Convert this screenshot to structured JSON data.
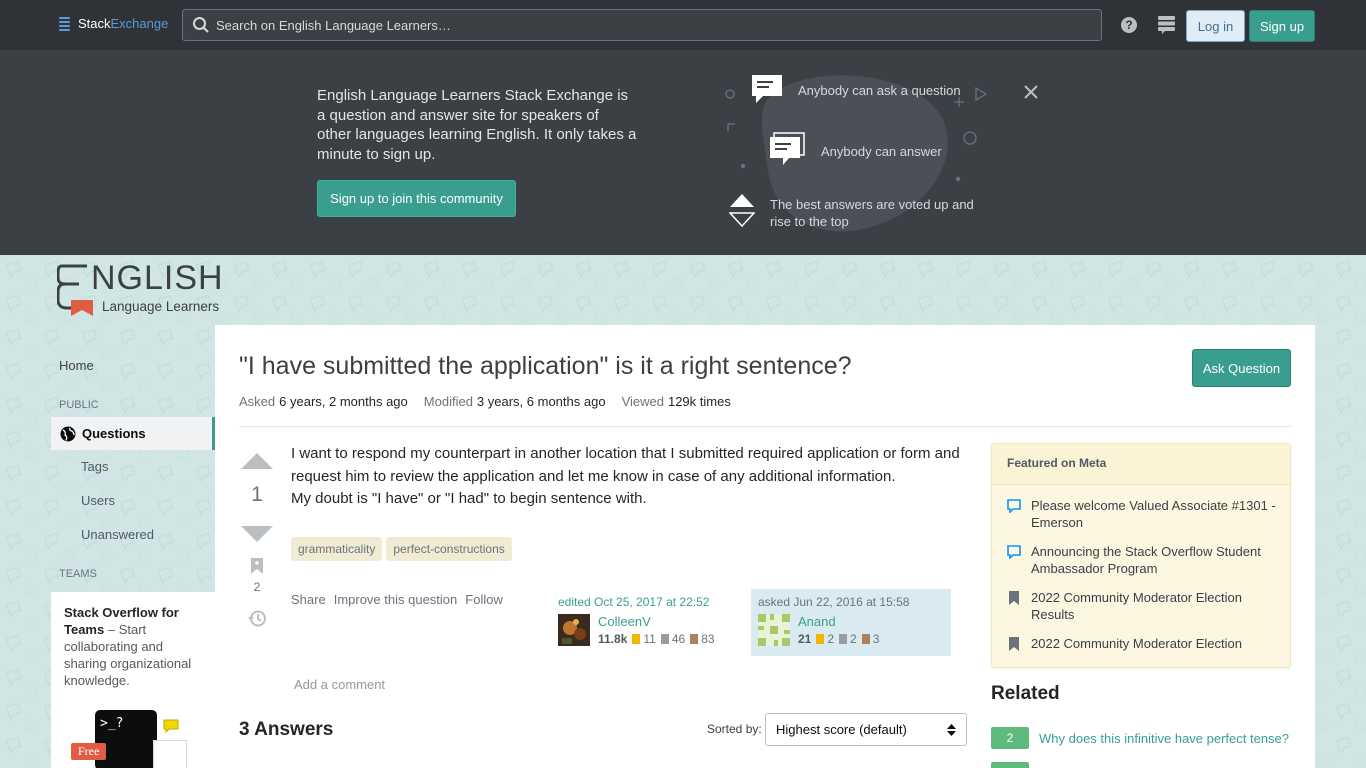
{
  "topbar": {
    "logo_stack": "Stack",
    "logo_exchange": "Exchange",
    "search_placeholder": "Search on English Language Learners…",
    "login_label": "Log in",
    "signup_label": "Sign up"
  },
  "banner": {
    "blurb": "English Language Learners Stack Exchange is a question and answer site for speakers of other languages learning English. It only takes a minute to sign up.",
    "join_label": "Sign up to join this community",
    "features": [
      "Anybody can ask a question",
      "Anybody can answer",
      "The best answers are voted up and rise to the top"
    ]
  },
  "site_logo": {
    "word": "NGLISH",
    "tagline": "Language Learners"
  },
  "sidebar": {
    "home": "Home",
    "public_section": "PUBLIC",
    "questions": "Questions",
    "tags": "Tags",
    "users": "Users",
    "unanswered": "Unanswered",
    "teams_section": "TEAMS",
    "teams_title": "Stack Overflow for Teams",
    "teams_text": "– Start collaborating and sharing organizational knowledge.",
    "free_badge": "Free",
    "terminal_text": ">_?"
  },
  "question": {
    "title": "\"I have submitted the application\" is it a right sentence?",
    "ask_label": "Ask Question",
    "asked_label": "Asked",
    "asked_value": "6 years, 2 months ago",
    "modified_label": "Modified",
    "modified_value": "3 years, 6 months ago",
    "viewed_label": "Viewed",
    "viewed_value": "129k times",
    "score": "1",
    "bookmarks": "2",
    "body_line1": "I want to respond my counterpart in another location that I submitted required application or form and request him to review the application and let me know in case of any additional information.",
    "body_line2": "My doubt is \"I have\" or \"I had\" to begin sentence with.",
    "tags": [
      "grammaticality",
      "perfect-constructions"
    ],
    "menu": [
      "Share",
      "Improve this question",
      "Follow"
    ],
    "editor": {
      "when": "edited Oct 25, 2017 at 22:52",
      "name": "ColleenV",
      "rep": "11.8k",
      "gold": "11",
      "silver": "46",
      "bronze": "83"
    },
    "asker": {
      "when": "asked Jun 22, 2016 at 15:58",
      "name": "Anand",
      "rep": "21",
      "gold": "2",
      "silver": "2",
      "bronze": "3"
    },
    "add_comment": "Add a comment"
  },
  "answers": {
    "heading": "3 Answers",
    "sorted_label": "Sorted by:",
    "sort_value": "Highest score (default)"
  },
  "featured": {
    "heading": "Featured on Meta",
    "items": [
      "Please welcome Valued Associate #1301 - Emerson",
      "Announcing the Stack Overflow Student Ambassador Program",
      "2022 Community Moderator Election Results",
      "2022 Community Moderator Election"
    ]
  },
  "related": {
    "heading": "Related",
    "items": [
      {
        "score": "2",
        "title": "Why does this infinitive have perfect tense?"
      }
    ]
  },
  "colors": {
    "accent": "#3a9e8f",
    "topbar": "#2f3337",
    "banner": "#3b4045",
    "link_blue": "#5b9bd5"
  }
}
